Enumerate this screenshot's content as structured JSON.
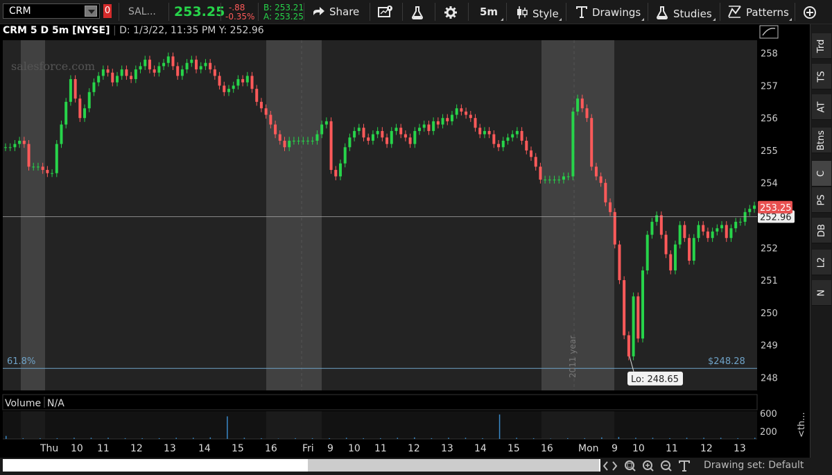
{
  "toolbar": {
    "symbol": "CRM",
    "alert_badge": "0",
    "company_short": "SAL...",
    "last_price": "253.25",
    "change": "-.88",
    "change_pct": "-0.35%",
    "bid": "B: 253.21",
    "ask": "A: 253.25",
    "share_label": "Share",
    "timeframe_label": "5m",
    "style_label": "Style",
    "drawings_label": "Drawings",
    "studies_label": "Studies",
    "patterns_label": "Patterns",
    "colors": {
      "up": "#27d44a",
      "down": "#ff5a5a"
    }
  },
  "chart_header": {
    "title": "CRM 5 D 5m [NYSE]",
    "date": "D: 1/3/22, 11:35 PM",
    "y_value": "Y: 252.96"
  },
  "chart": {
    "watermark": "salesforce.com",
    "fib_label": "61.8%",
    "fib_price_label": "$248.28",
    "lo_label": "Lo: 248.65",
    "price_tag": "253.25",
    "crosshair_tag": "252.96",
    "year_marker": "2011 year",
    "volume_title": "Volume",
    "volume_value": "N/A",
    "volume_ticks": [
      "600",
      "200"
    ],
    "drawing_set": "Drawing set: Default",
    "collapse_label": "<th..."
  },
  "chart_data": {
    "type": "line",
    "title": "CRM 5 D 5m [NYSE]",
    "y_ticks": [
      258,
      257,
      256,
      255,
      254,
      253,
      252,
      251,
      250,
      249,
      248
    ],
    "ylim": [
      247.6,
      258.4
    ],
    "x_tick_labels": [
      "Thu",
      "10",
      "11",
      "12",
      "13",
      "14",
      "15",
      "16",
      "Fri",
      "9",
      "10",
      "11",
      "12",
      "13",
      "14",
      "15",
      "16",
      "Mon",
      "9",
      "10",
      "11",
      "12",
      "13"
    ],
    "fib_level": 248.28,
    "last_price": 253.25,
    "crosshair_price": 252.96,
    "session_low": 248.65,
    "series": [
      {
        "values": [
          255.1,
          255.1,
          255.2,
          255.3,
          255.2,
          254.5,
          254.5,
          254.5,
          254.4,
          254.3,
          254.3,
          255.2,
          255.8,
          256.5,
          257.2,
          256.6,
          256.0,
          256.3,
          256.8,
          257.1,
          257.3,
          257.5,
          257.4,
          257.1,
          257.3,
          257.5,
          257.3,
          257.2,
          257.5,
          257.6,
          257.8,
          257.5,
          257.4,
          257.6,
          257.7,
          257.9,
          257.6,
          257.3,
          257.5,
          257.7,
          257.8,
          257.5,
          257.6,
          257.7,
          257.5,
          257.3,
          257.0,
          256.8,
          256.9,
          257.0,
          257.2,
          257.1,
          257.3,
          256.9,
          256.5,
          256.3,
          256.1,
          255.8,
          255.5,
          255.3,
          255.1,
          255.3,
          255.3,
          255.3,
          255.3,
          255.3,
          255.3,
          255.5,
          255.8,
          255.9,
          254.4,
          254.2,
          254.6,
          255.1,
          255.4,
          255.6,
          255.7,
          255.4,
          255.3,
          255.5,
          255.6,
          255.4,
          255.2,
          255.6,
          255.7,
          255.5,
          255.4,
          255.2,
          255.6,
          255.7,
          255.8,
          255.6,
          255.9,
          255.8,
          256.0,
          255.9,
          256.1,
          256.3,
          256.2,
          256.1,
          256.0,
          255.7,
          255.5,
          255.6,
          255.5,
          255.2,
          255.1,
          255.3,
          255.4,
          255.5,
          255.6,
          255.3,
          255.0,
          254.8,
          254.5,
          254.1,
          254.1,
          254.1,
          254.1,
          254.1,
          254.2,
          254.2,
          256.2,
          256.6,
          256.3,
          256.0,
          254.5,
          254.2,
          254.0,
          253.4,
          253.1,
          252.1,
          251.0,
          249.3,
          248.65,
          250.5,
          249.2,
          251.3,
          252.4,
          252.8,
          253.0,
          252.4,
          251.8,
          251.3,
          252.1,
          252.7,
          252.3,
          251.6,
          252.3,
          252.7,
          252.5,
          252.3,
          252.5,
          252.6,
          252.7,
          252.3,
          252.6,
          252.8,
          252.8,
          253.1,
          253.2,
          253.3
        ]
      }
    ],
    "volume_series": [
      8,
      2,
      2,
      2,
      3,
      3,
      3,
      2,
      2,
      2,
      3,
      3,
      4,
      60,
      3,
      2,
      1,
      2,
      2,
      2,
      3,
      2,
      2,
      3,
      4,
      2,
      3,
      3,
      2,
      65,
      3,
      2,
      1,
      2,
      2,
      4,
      5,
      3,
      3,
      2,
      3,
      3,
      3,
      2,
      3
    ]
  },
  "right_tabs": [
    "Trd",
    "TS",
    "AT",
    "Btns",
    "C",
    "PS",
    "DB",
    "L2",
    "N"
  ]
}
